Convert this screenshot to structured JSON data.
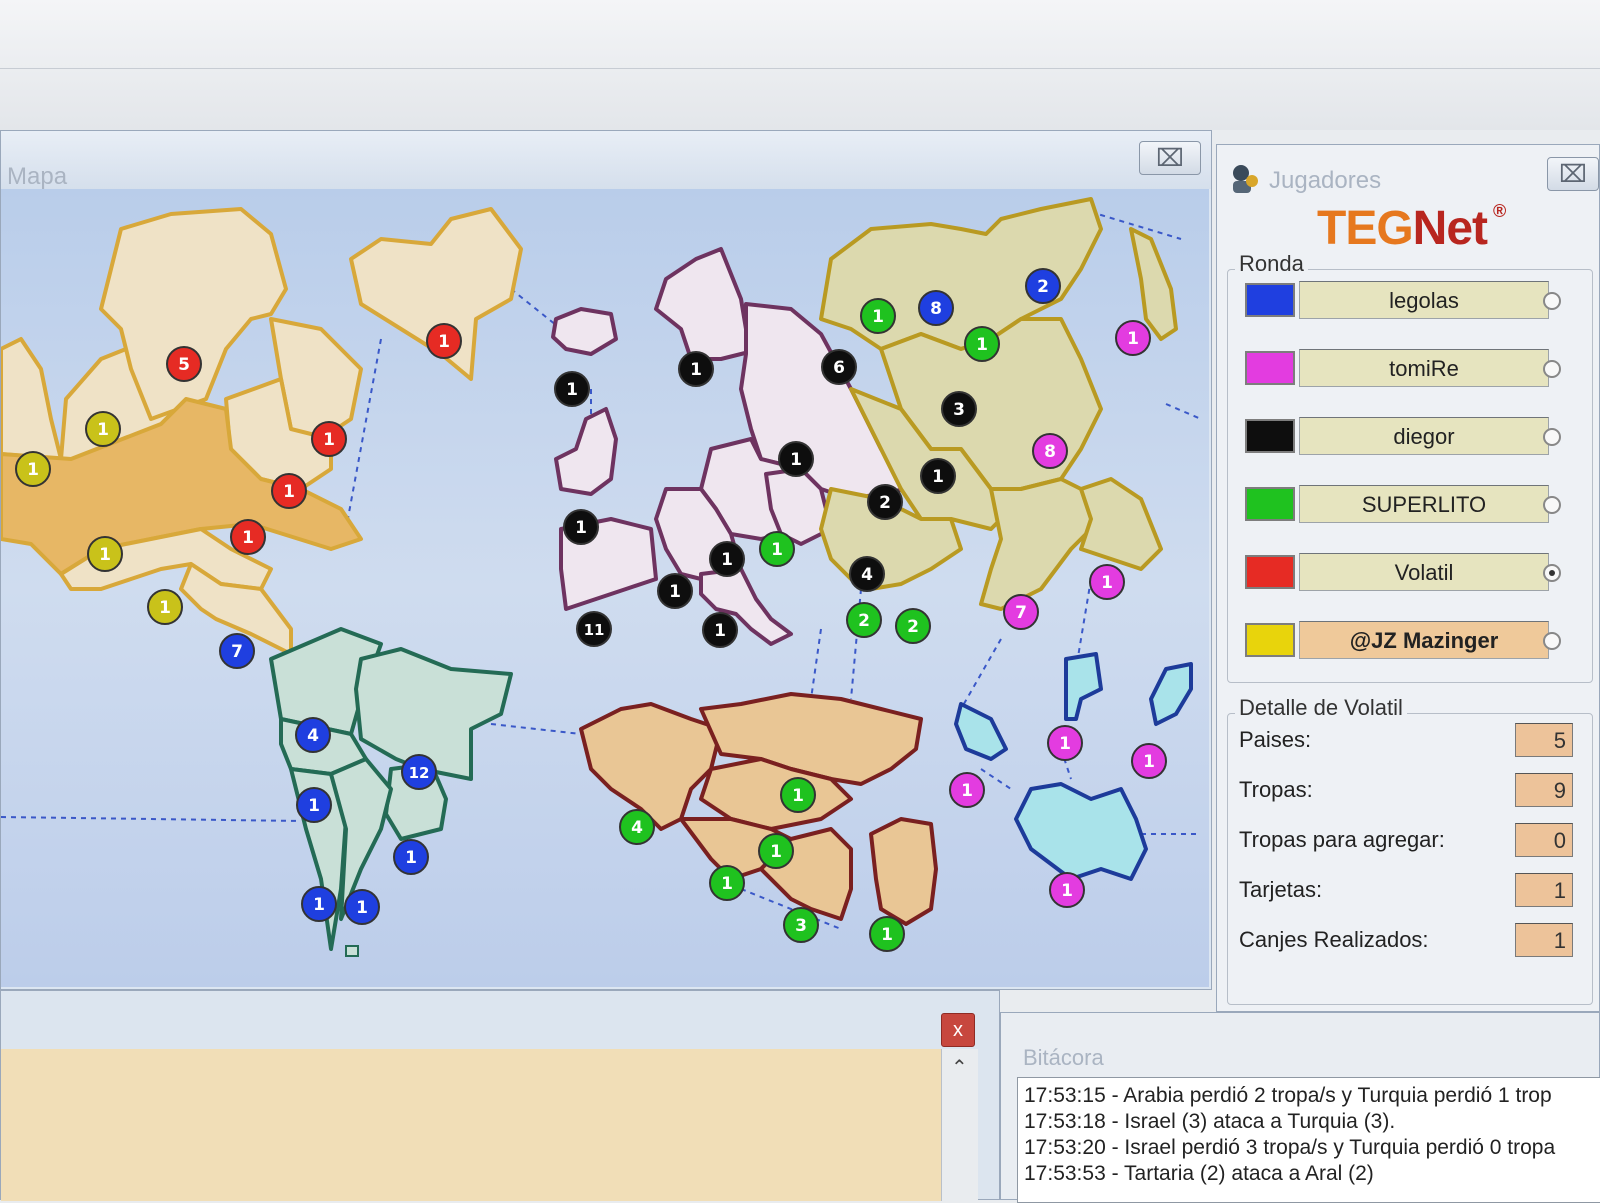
{
  "map_window": {
    "title": "Mapa",
    "close_symbol": "⌧"
  },
  "players_window": {
    "title": "Jugadores",
    "close_symbol": "⌧",
    "logo_part1": "TEG",
    "logo_part2": "Net",
    "logo_mark": "®",
    "round_label": "Ronda",
    "players": [
      {
        "name": "legolas",
        "color": "#1f3fe0",
        "active": false
      },
      {
        "name": "tomiRe",
        "color": "#e33ce0",
        "active": false
      },
      {
        "name": "diegor",
        "color": "#0e0e0e",
        "active": false
      },
      {
        "name": "SUPERLITO",
        "color": "#1fc21f",
        "active": false
      },
      {
        "name": "Volatil",
        "color": "#e62b24",
        "active": true
      },
      {
        "name": "@JZ Mazinger",
        "color": "#e8d40c",
        "active": false
      }
    ],
    "detail_label": "Detalle de Volatil",
    "details": [
      {
        "label": "Paises:",
        "value": "5"
      },
      {
        "label": "Tropas:",
        "value": "9"
      },
      {
        "label": "Tropas para agregar:",
        "value": "0"
      },
      {
        "label": "Tarjetas:",
        "value": "1"
      },
      {
        "label": "Canjes Realizados:",
        "value": "1"
      }
    ]
  },
  "chat_window": {
    "close_symbol": "x",
    "scroll_up": "⌃"
  },
  "log_window": {
    "title": "Bitácora",
    "lines": [
      "17:53:15 - Arabia perdió 2 tropa/s y Turquia perdió 1 trop",
      "17:53:18 - Israel (3) ataca a Turquia (3).",
      "17:53:20 - Israel perdió 3 tropa/s y Turquia perdió 0 tropa",
      "17:53:53 - Tartaria (2) ataca a Aral (2)"
    ]
  },
  "colors": {
    "blue": "#1f3fe0",
    "pink": "#e33ce0",
    "black": "#0e0e0e",
    "green": "#1fc21f",
    "red": "#e62b24",
    "yellow": "#c9c21a",
    "north_america": "#efe2c6",
    "north_america_dark": "#e7b765",
    "south_america": "#c9e0d7",
    "europe": "#efe6ef",
    "asia": "#dcd9ae",
    "africa": "#e9c695",
    "oceania": "#a9e3ea"
  },
  "map": {
    "territories": [
      {
        "owner": "yellow",
        "troops": "1"
      },
      {
        "owner": "yellow",
        "troops": "1"
      },
      {
        "owner": "red",
        "troops": "5"
      },
      {
        "owner": "red",
        "troops": "1"
      },
      {
        "owner": "red",
        "troops": "1"
      },
      {
        "owner": "red",
        "troops": "1"
      },
      {
        "owner": "red",
        "troops": "1"
      },
      {
        "owner": "yellow",
        "troops": "1"
      },
      {
        "owner": "yellow",
        "troops": "1"
      },
      {
        "owner": "blue",
        "troops": "7"
      },
      {
        "owner": "blue",
        "troops": "4"
      },
      {
        "owner": "blue",
        "troops": "12"
      },
      {
        "owner": "blue",
        "troops": "1"
      },
      {
        "owner": "blue",
        "troops": "1"
      },
      {
        "owner": "blue",
        "troops": "1"
      },
      {
        "owner": "blue",
        "troops": "1"
      },
      {
        "owner": "black",
        "troops": "1"
      },
      {
        "owner": "black",
        "troops": "1"
      },
      {
        "owner": "black",
        "troops": "1"
      },
      {
        "owner": "black",
        "troops": "1"
      },
      {
        "owner": "black",
        "troops": "1"
      },
      {
        "owner": "black",
        "troops": "1"
      },
      {
        "owner": "green",
        "troops": "1"
      },
      {
        "owner": "black",
        "troops": "11"
      },
      {
        "owner": "black",
        "troops": "1"
      },
      {
        "owner": "green",
        "troops": "1"
      },
      {
        "owner": "blue",
        "troops": "8"
      },
      {
        "owner": "blue",
        "troops": "2"
      },
      {
        "owner": "black",
        "troops": "6"
      },
      {
        "owner": "green",
        "troops": "1"
      },
      {
        "owner": "black",
        "troops": "3"
      },
      {
        "owner": "black",
        "troops": "1"
      },
      {
        "owner": "black",
        "troops": "2"
      },
      {
        "owner": "black",
        "troops": "4"
      },
      {
        "owner": "green",
        "troops": "2"
      },
      {
        "owner": "green",
        "troops": "2"
      },
      {
        "owner": "pink",
        "troops": "1"
      },
      {
        "owner": "pink",
        "troops": "8"
      },
      {
        "owner": "pink",
        "troops": "7"
      },
      {
        "owner": "pink",
        "troops": "1"
      },
      {
        "owner": "green",
        "troops": "4"
      },
      {
        "owner": "green",
        "troops": "1"
      },
      {
        "owner": "green",
        "troops": "1"
      },
      {
        "owner": "green",
        "troops": "1"
      },
      {
        "owner": "green",
        "troops": "3"
      },
      {
        "owner": "green",
        "troops": "1"
      },
      {
        "owner": "pink",
        "troops": "1"
      },
      {
        "owner": "pink",
        "troops": "1"
      },
      {
        "owner": "pink",
        "troops": "1"
      },
      {
        "owner": "pink",
        "troops": "1"
      }
    ]
  }
}
